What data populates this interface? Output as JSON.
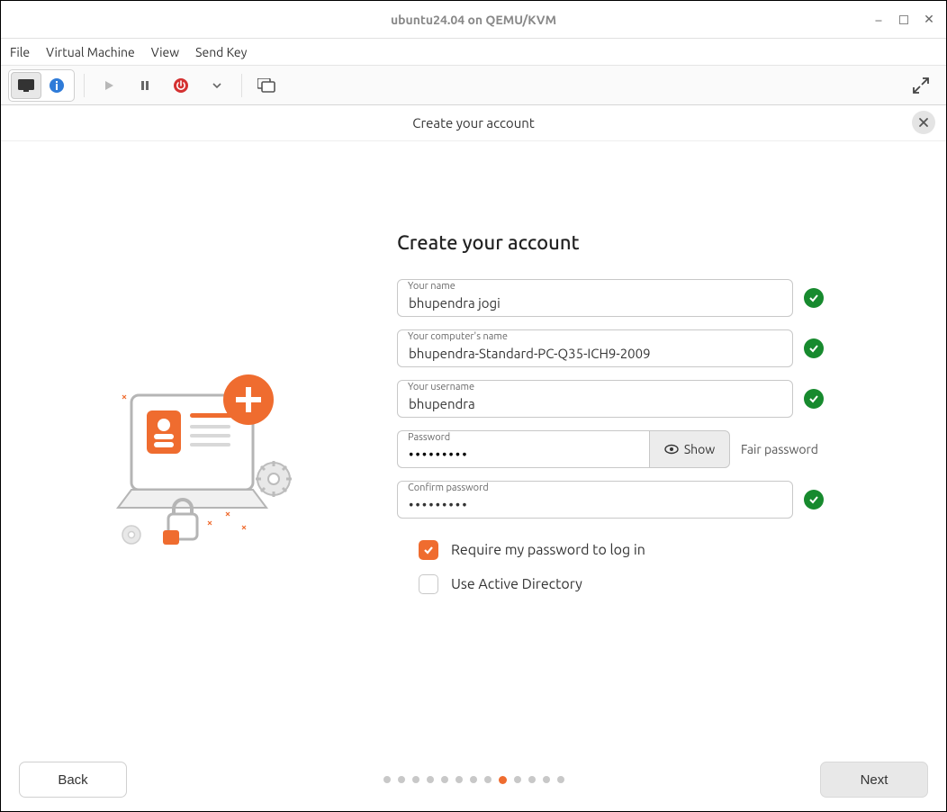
{
  "window": {
    "title": "ubuntu24.04 on QEMU/KVM"
  },
  "menubar": {
    "file": "File",
    "virtual_machine": "Virtual Machine",
    "view": "View",
    "send_key": "Send Key"
  },
  "content_header": {
    "title": "Create your account"
  },
  "form": {
    "heading": "Create your account",
    "name_label": "Your name",
    "name_value": "bhupendra jogi",
    "computer_label": "Your computer's name",
    "computer_value": "bhupendra-Standard-PC-Q35-ICH9-2009",
    "username_label": "Your username",
    "username_value": "bhupendra",
    "password_label": "Password",
    "password_value": "•••••••••",
    "show_label": "Show",
    "strength_text": "Fair password",
    "confirm_label": "Confirm password",
    "confirm_value": "•••••••••",
    "require_pw_label": "Require my password to log in",
    "use_ad_label": "Use Active Directory"
  },
  "footer": {
    "back_label": "Back",
    "next_label": "Next",
    "active_step": 9,
    "total_steps": 13
  }
}
